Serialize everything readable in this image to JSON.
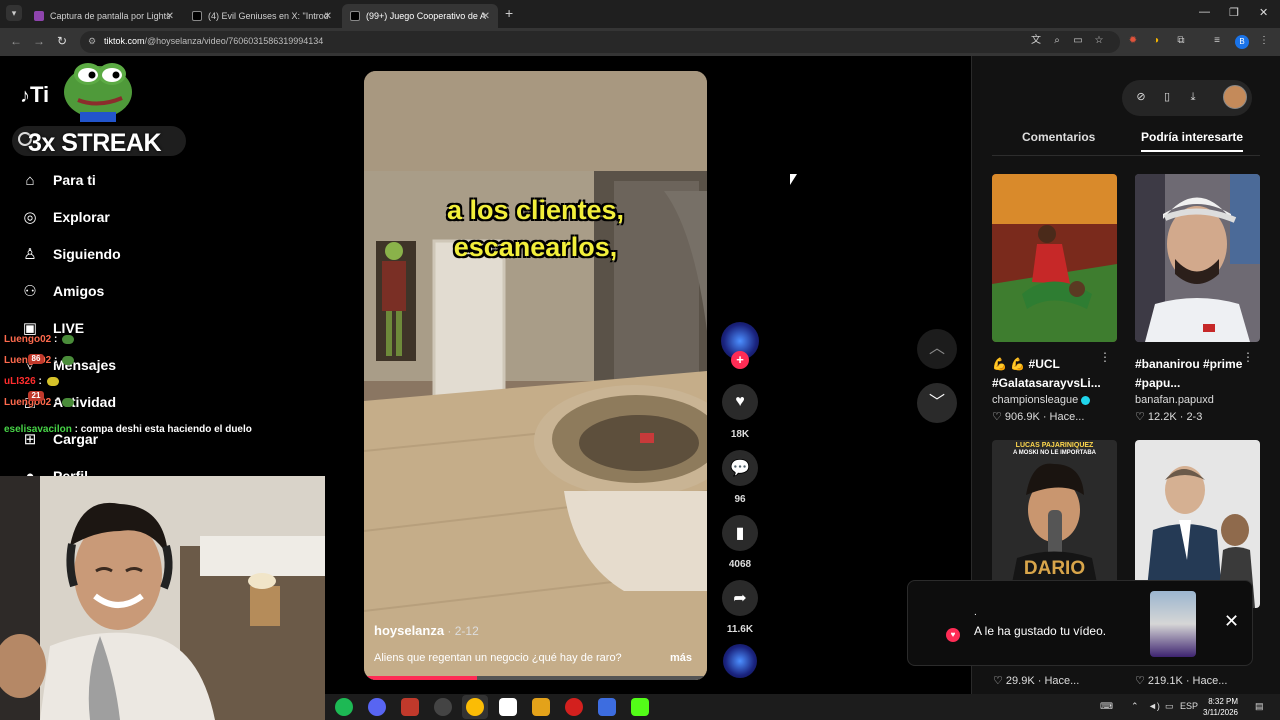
{
  "browser": {
    "tabs": [
      {
        "title": "Captura de pantalla por Lightsh",
        "favicon_color": "#8e44ad"
      },
      {
        "title": "(4) Evil Geniuses en X: \"Introdu",
        "favicon_color": "#000000"
      },
      {
        "title": "(99+) Juego Cooperativo de Ali",
        "favicon_color": "#000000"
      }
    ],
    "url_host": "tiktok.com",
    "url_path": "/@hoyselanza/video/7606031586319994134",
    "profile_initial": "B"
  },
  "sidebar": {
    "logo": "Ti",
    "items": [
      {
        "label": "Para ti",
        "icon": "home-icon"
      },
      {
        "label": "Explorar",
        "icon": "compass-icon"
      },
      {
        "label": "Siguiendo",
        "icon": "user-follow-icon"
      },
      {
        "label": "Amigos",
        "icon": "friends-icon"
      },
      {
        "label": "LIVE",
        "icon": "live-icon"
      },
      {
        "label": "Mensajes",
        "icon": "messages-icon"
      },
      {
        "label": "Actividad",
        "icon": "activity-icon"
      },
      {
        "label": "Cargar",
        "icon": "upload-icon"
      },
      {
        "label": "Perfil",
        "icon": "profile-icon"
      }
    ]
  },
  "overlay": {
    "streak": "3x STREAK",
    "chat": [
      {
        "user": "Luengo02",
        "text": ":"
      },
      {
        "user": "Luengo02",
        "text": ":"
      },
      {
        "user": "uLI326",
        "text": ":"
      },
      {
        "user": "Luengo02",
        "text": ":"
      },
      {
        "user": "eselisavacilon",
        "text": ": compa deshi esta haciendo el duelo"
      }
    ],
    "badges": [
      "86",
      "21"
    ]
  },
  "video": {
    "caption_line1": "a los clientes,",
    "caption_line2": "escanearlos,",
    "author": "hoyselanza",
    "date": " · 2-12",
    "description": "Aliens que regentan un negocio ¿qué hay de raro?",
    "more": "más",
    "progress_percent": 33,
    "likes": "18K",
    "comments": "96",
    "saves": "4068",
    "shares": "11.6K"
  },
  "right_panel": {
    "tabs": [
      "Comentarios",
      "Podría interesarte"
    ],
    "cards": [
      {
        "title": "💪 💪 #UCL #GalatasarayvsLi...",
        "author": "championsleague",
        "verified": true,
        "meta": "♡ 906.9K · Hace..."
      },
      {
        "title": "#bananirou #prime #papu...",
        "author": "banafan.papuxd",
        "verified": false,
        "meta": "♡ 12.2K · 2-3"
      },
      {
        "title": "",
        "author": "",
        "verified": false,
        "meta": "♡ 29.9K · Hace..."
      },
      {
        "title": "",
        "author": "",
        "verified": false,
        "meta": "♡ 219.1K · Hace..."
      }
    ],
    "thumb_texts": [
      "LUCAS PAJARINIQUEZ",
      "A MOSKI NO LE IMPORTABA",
      "DARIO"
    ]
  },
  "toast": {
    "dot": ".",
    "message": "A le ha gustado tu vídeo."
  },
  "taskbar": {
    "lang": "ESP",
    "time": "8:32 PM",
    "date": "3/11/2026"
  },
  "colors": {
    "accent": "#fe2c55",
    "caption": "#f2ef3b",
    "verified": "#20d5ec"
  }
}
